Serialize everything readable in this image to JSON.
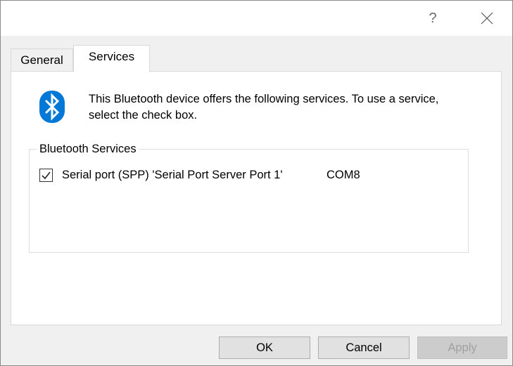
{
  "titlebar": {
    "help_label": "?",
    "close_icon": "close-icon"
  },
  "tabs": [
    {
      "label": "General"
    },
    {
      "label": "Services"
    }
  ],
  "intro": {
    "icon": "bluetooth-icon",
    "text": "This Bluetooth device offers the following services. To use a service, select the check box."
  },
  "group": {
    "legend": "Bluetooth Services",
    "services": [
      {
        "checked": true,
        "name": "Serial port (SPP) 'Serial Port Server Port 1'",
        "port": "COM8"
      }
    ]
  },
  "buttons": {
    "ok": "OK",
    "cancel": "Cancel",
    "apply": "Apply"
  },
  "colors": {
    "bluetooth_blue": "#0078d7",
    "panel": "#ffffff",
    "window": "#f0f0f0"
  }
}
